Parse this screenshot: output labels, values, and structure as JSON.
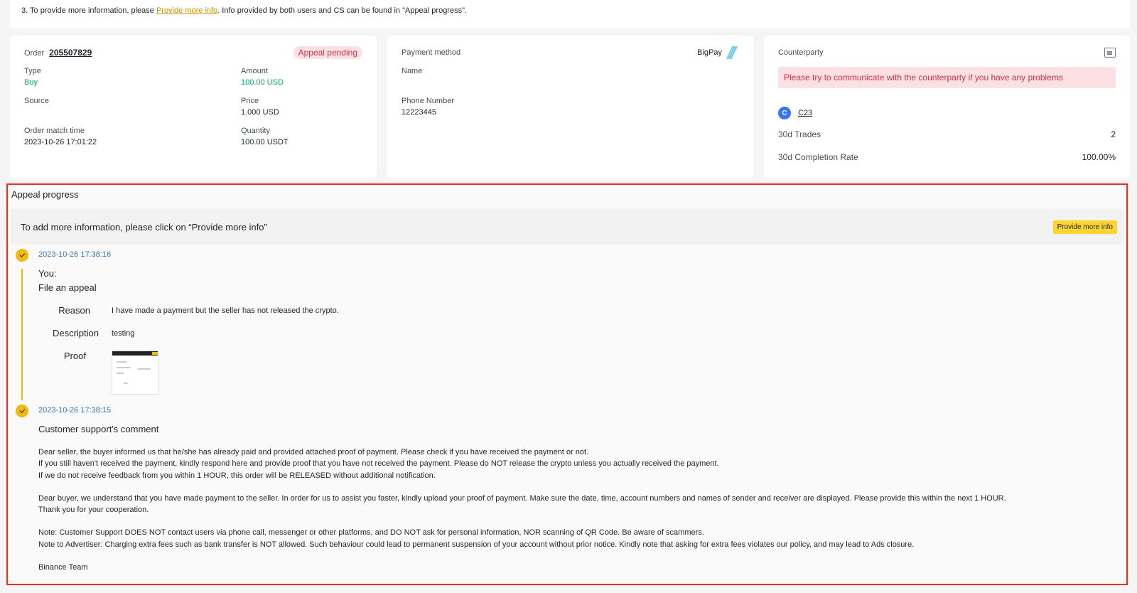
{
  "top_note": {
    "prefix": "3. To provide more information, please ",
    "link": "Provide more info",
    "suffix": ". Info provided by both users and CS can be found in \"Appeal progress\"."
  },
  "order": {
    "label": "Order",
    "number": "205507829",
    "status": "Appeal pending",
    "type_label": "Type",
    "type_value": "Buy",
    "amount_label": "Amount",
    "amount_value": "100.00 USD",
    "source_label": "Source",
    "source_value": "",
    "price_label": "Price",
    "price_value": "1.000 USD",
    "match_time_label": "Order match time",
    "match_time_value": "2023-10-26 17:01:22",
    "quantity_label": "Quantity",
    "quantity_value": "100.00 USDT"
  },
  "payment": {
    "label": "Payment method",
    "method": "BigPay",
    "name_label": "Name",
    "name_value": "",
    "phone_label": "Phone Number",
    "phone_value": "12223445"
  },
  "counterparty": {
    "label": "Counterparty",
    "warning": "Please try to communicate with the counterparty if you have any problems",
    "avatar_letter": "C",
    "username": "C23",
    "trades_label": "30d Trades",
    "trades_value": "2",
    "completion_label": "30d Completion Rate",
    "completion_value": "100.00%",
    "chat_icon": "chat-icon"
  },
  "appeal": {
    "title": "Appeal progress",
    "info_text": "To add more information, please click on “Provide more info”",
    "provide_button": "Provide more info",
    "entries": [
      {
        "timestamp": "2023-10-26 17:38:16",
        "who": "You:",
        "action": "File an appeal",
        "reason_label": "Reason",
        "reason_value": "I have made a payment but the seller has not released the crypto.",
        "description_label": "Description",
        "description_value": "testing",
        "proof_label": "Proof"
      },
      {
        "timestamp": "2023-10-26 17:38:15",
        "title": "Customer support's comment",
        "p1_l1": "Dear seller, the buyer informed us that he/she has already paid and provided attached proof of payment. Please check if you have received the payment or not.",
        "p1_l2": "If you still haven't received the payment, kindly respond here and provide proof that you have not received the payment. Please do NOT release the crypto unless you actually received the payment.",
        "p1_l3": "If we do not receive feedback from you within 1 HOUR, this order will be RELEASED without additional notification.",
        "p2": "Dear buyer, we understand that you have made payment to the seller. In order for us to assist you faster, kindly upload your proof of payment. Make sure the date, time, account numbers and names of sender and receiver are displayed. Please provide this within the next 1 HOUR. Thank you for your cooperation.",
        "p3_l1": "Note: Customer Support DOES NOT contact users via phone call, messenger or other platforms, and DO NOT ask for personal information, NOR scanning of QR Code. Be aware of scammers.",
        "p3_l2": "Note to Advertiser: Charging extra fees such as bank transfer is NOT allowed. Such behaviour could lead to permanent suspension of your account without prior notice. Kindly note that asking for extra fees violates our policy, and may lead to Ads closure.",
        "signature": "Binance Team"
      }
    ]
  },
  "colors": {
    "accent_yellow": "#fcd535",
    "link_gold": "#c99400",
    "buy_green": "#03a66d",
    "alert_red": "#cf304a",
    "highlight_border": "#f02a1c",
    "timestamp_blue": "#3375bb"
  }
}
